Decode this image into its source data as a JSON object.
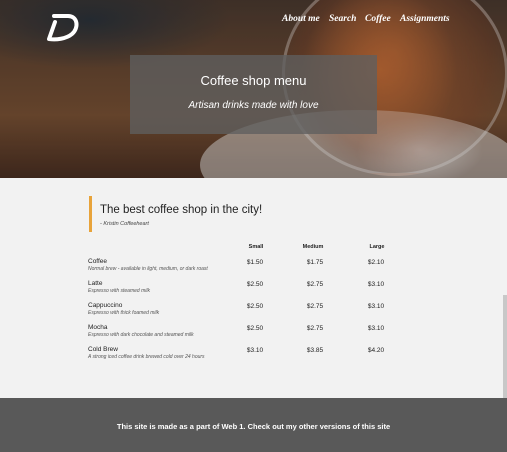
{
  "nav": {
    "logo_icon": "d-logo-icon",
    "items": [
      {
        "label": "About me"
      },
      {
        "label": "Search"
      },
      {
        "label": "Coffee"
      },
      {
        "label": "Assignments"
      }
    ]
  },
  "hero": {
    "title": "Coffee shop menu",
    "subtitle": "Artisan drinks made with love"
  },
  "quote": {
    "text": "The best coffee shop in the city!",
    "author": "- Kristin Coffeeheart"
  },
  "menu": {
    "columns": [
      "Small",
      "Medium",
      "Large"
    ],
    "items": [
      {
        "name": "Coffee",
        "description": "Normal brew - available in light, medium, or dark roast",
        "prices": [
          "$1.50",
          "$1.75",
          "$2.10"
        ]
      },
      {
        "name": "Latte",
        "description": "Espresso with steamed milk",
        "prices": [
          "$2.50",
          "$2.75",
          "$3.10"
        ]
      },
      {
        "name": "Cappuccino",
        "description": "Espresso with thick foamed milk",
        "prices": [
          "$2.50",
          "$2.75",
          "$3.10"
        ]
      },
      {
        "name": "Mocha",
        "description": "Espresso with dark chocolate and steamed milk",
        "prices": [
          "$2.50",
          "$2.75",
          "$3.10"
        ]
      },
      {
        "name": "Cold Brew",
        "description": "A strong iced coffee drink brewed cold over 24 hours",
        "prices": [
          "$3.10",
          "$3.85",
          "$4.20"
        ]
      }
    ]
  },
  "footer": {
    "text": "This site is made as a part of Web 1. Check out my other versions of this site"
  },
  "colors": {
    "accent": "#e8a33a",
    "footer_bg": "#595959",
    "hero_box": "#5f5f5f"
  }
}
